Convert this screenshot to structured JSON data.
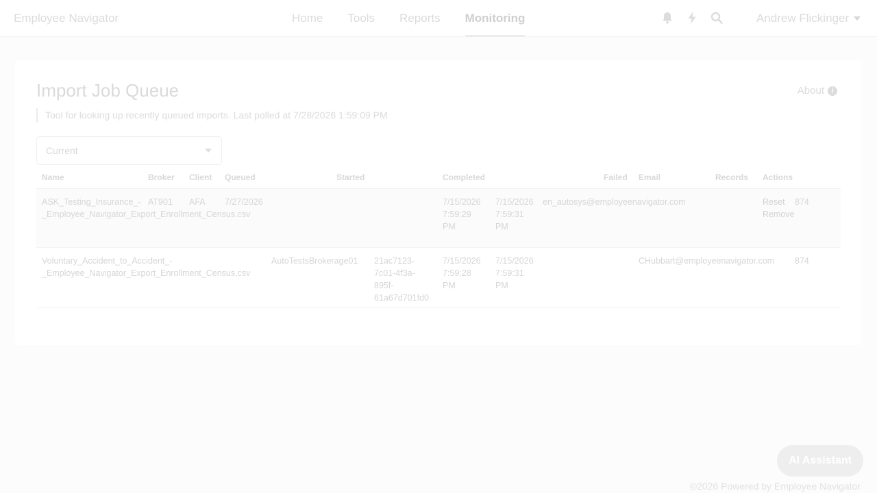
{
  "app": {
    "brand": "Employee Navigator"
  },
  "nav": {
    "items": [
      "Home",
      "Tools",
      "Reports",
      "Monitoring"
    ],
    "active": "Monitoring"
  },
  "header_icons": [
    "bell-icon",
    "bolt-icon",
    "search-icon"
  ],
  "user": {
    "name": "Andrew Flickinger"
  },
  "page": {
    "title": "Import Job Queue",
    "about_label": "About",
    "subtitle": "Tool for looking up recently queued imports. Last polled at 7/28/2026 1:59:09 PM",
    "filter": {
      "selected": "Current"
    }
  },
  "table": {
    "columns": [
      "Name",
      "Broker",
      "Client",
      "Queued",
      "Started",
      "Completed",
      "Failed",
      "Email",
      "Records",
      "Actions"
    ],
    "rows": [
      {
        "name": "ASK_Testing_Insurance_-\n_Employee_Navigator_Export_Enrollment_Census.csv",
        "broker": "AT901",
        "client": "AFA",
        "queued": "7/27/2026",
        "started": "7/15/2026\n7:59:29\nPM",
        "completed": "7/15/2026\n7:59:31\nPM",
        "failed": "",
        "email": "en_autosys@employeenavigator.com",
        "records": "874",
        "actions": [
          "Reset",
          "Remove"
        ]
      },
      {
        "name": "Voluntary_Accident_to_Accident_-\n_Employee_Navigator_Export_Enrollment_Census.csv",
        "broker": "AutoTestsBrokerage01",
        "client": "21ac7123-\n7c01-4f3a-\n895f-\n61a67d701fd0",
        "queued": "",
        "started": "7/15/2026\n7:59:28\nPM",
        "completed": "7/15/2026\n7:59:31\nPM",
        "failed": "",
        "email": "CHubbart@employeenavigator.com",
        "records": "874",
        "actions": []
      }
    ]
  },
  "assistant": {
    "label": "AI Assistant"
  },
  "footer": {
    "copyright": "©2026 Powered by Employee Navigator"
  },
  "colors": {
    "background": "#fcfcfc",
    "card": "#ffffff",
    "muted_text": "#d6d6d6"
  }
}
